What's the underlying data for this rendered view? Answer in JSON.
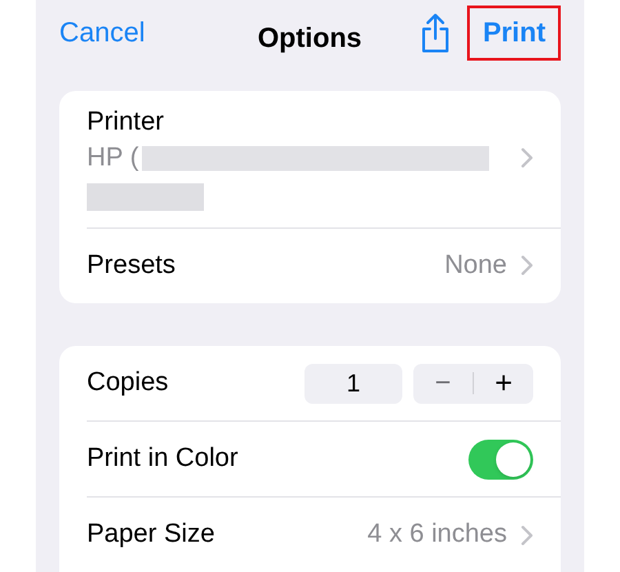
{
  "nav_bar": {
    "cancel": "Cancel",
    "title": "Options",
    "print": {
      "label": "Print",
      "highlighted": true
    }
  },
  "printer_section": {
    "printer": {
      "label": "Printer",
      "value": "HP (",
      "redacted": true
    },
    "presets": {
      "label": "Presets",
      "value": "None"
    }
  },
  "settings_section": [
    {
      "kind": "stepper",
      "label": "Copies",
      "value": "1",
      "minus": "−",
      "plus": "+"
    },
    {
      "kind": "toggle",
      "label": "Print in Color",
      "on": true
    },
    {
      "kind": "disclosure",
      "label": "Paper Size",
      "value": "4 x 6 inches"
    }
  ]
}
